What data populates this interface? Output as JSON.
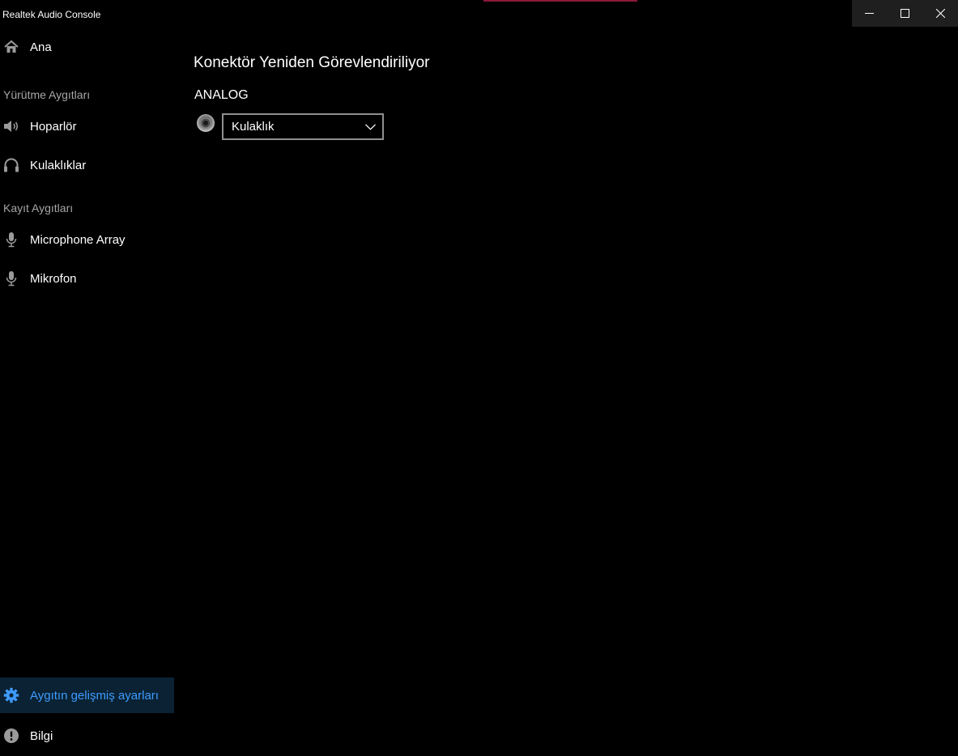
{
  "window": {
    "title": "Realtek Audio Console",
    "accent_color": "#8a1a3a",
    "caption": {
      "minimize": "minimize-icon",
      "maximize": "maximize-icon",
      "close": "close-icon"
    }
  },
  "sidebar": {
    "home": {
      "label": "Ana",
      "icon": "home-icon"
    },
    "playback_header": "Yürütme Aygıtları",
    "playback_items": [
      {
        "label": "Hoparlör",
        "icon": "speaker-icon"
      },
      {
        "label": "Kulaklıklar",
        "icon": "headphones-icon"
      }
    ],
    "recording_header": "Kayıt Aygıtları",
    "recording_items": [
      {
        "label": "Microphone Array",
        "icon": "microphone-icon"
      },
      {
        "label": "Mikrofon",
        "icon": "microphone-icon"
      }
    ],
    "advanced": {
      "label": "Aygıtın gelişmiş ayarları",
      "icon": "gear-icon",
      "active_color": "#3e9bff"
    },
    "info": {
      "label": "Bilgi",
      "icon": "info-icon"
    }
  },
  "main": {
    "title": "Konektör Yeniden Görevlendiriliyor",
    "group_label": "ANALOG",
    "connector": {
      "icon": "audio-jack-icon",
      "selected": "Kulaklık"
    }
  }
}
